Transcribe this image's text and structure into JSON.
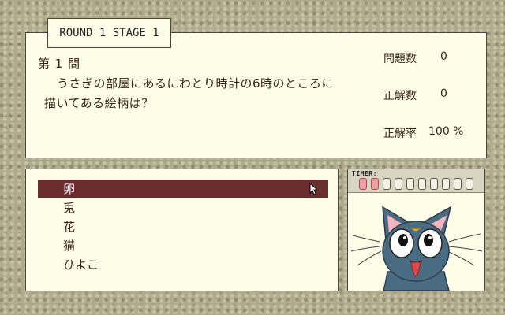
{
  "round_label": "ROUND 1 STAGE 1",
  "question": {
    "number_label": "第 1 問",
    "line1": "うさぎの部屋にあるにわとり時計の6時のところに",
    "line2": "描いてある絵柄は？"
  },
  "stats": {
    "questions_label": "問題数",
    "questions_value": "0",
    "correct_label": "正解数",
    "correct_value": "0",
    "rate_label": "正解率",
    "rate_value": "100 %"
  },
  "answers": [
    {
      "label": "卵",
      "selected": true
    },
    {
      "label": "兎",
      "selected": false
    },
    {
      "label": "花",
      "selected": false
    },
    {
      "label": "猫",
      "selected": false
    },
    {
      "label": "ひよこ",
      "selected": false
    }
  ],
  "timer": {
    "label": "TIMER:",
    "total_cells": 10,
    "used_cells": 2
  },
  "colors": {
    "selected_answer_bg": "#6b2e2e",
    "panel_bg": "#fefde7",
    "timer_used": "#f0a0a0"
  },
  "mascot": {
    "icon": "luna-cat"
  }
}
